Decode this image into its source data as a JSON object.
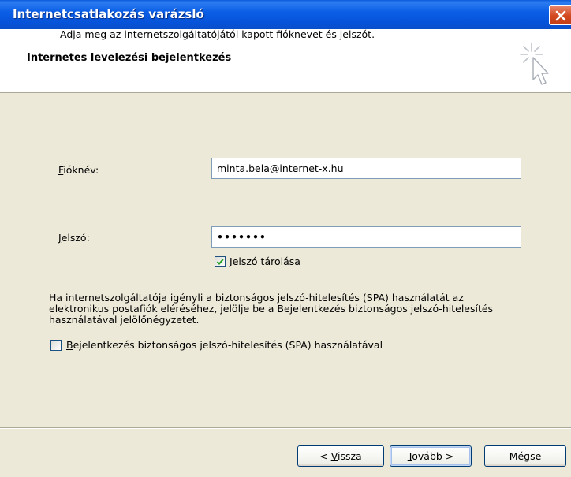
{
  "window": {
    "title": "Internetcsatlakozás varázsló"
  },
  "header": {
    "heading": "Internetes levelezési bejelentkezés",
    "icon": "wizard-cursor-sparkle-icon"
  },
  "form": {
    "instruction": "Adja meg az internetszolgáltatójától kapott fióknevet és jelszót.",
    "account_label_first": "F",
    "account_label_rest": "ióknév:",
    "account_value": "minta.bela@internet-x.hu",
    "password_label_first": "J",
    "password_label_rest": "elszó:",
    "password_value": "•••••••",
    "remember_checked": true,
    "remember_label_first": "J",
    "remember_label_rest": "elszó tárolása",
    "spa_info": "Ha internetszolgáltatója igényli a biztonságos jelszó-hitelesítés (SPA) használatát az elektronikus postafiók eléréséhez, jelölje be a Bejelentkezés biztonságos jelszó-hitelesítés használatával jelölőnégyzetet.",
    "spa_checked": false,
    "spa_label_first": "B",
    "spa_label_rest": "ejelentkezés biztonságos jelszó-hitelesítés (SPA) használatával"
  },
  "buttons": {
    "back_prefix": "< ",
    "back_mnemonic": "V",
    "back_rest": "issza",
    "next_mnemonic": "T",
    "next_rest": "ovább >",
    "cancel": "Mégse"
  },
  "colors": {
    "titlebar": "#0A5BDD",
    "dialog_bg": "#ECE9D8",
    "close_button": "#D3481F"
  }
}
